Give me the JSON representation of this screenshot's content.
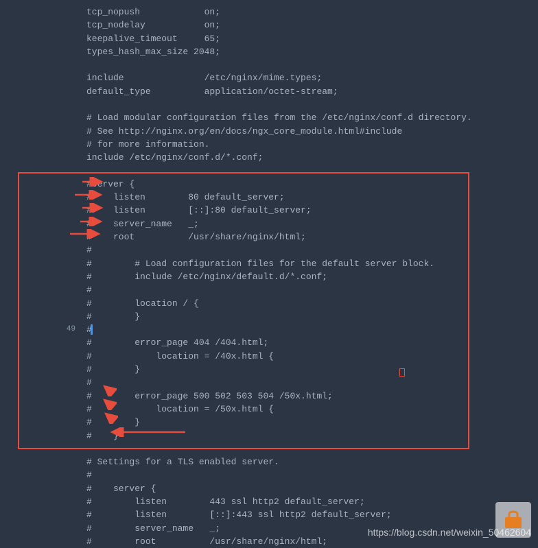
{
  "lines": [
    {
      "gutter": "",
      "code": "tcp_nopush            on;"
    },
    {
      "gutter": "",
      "code": "tcp_nodelay           on;"
    },
    {
      "gutter": "",
      "code": "keepalive_timeout     65;"
    },
    {
      "gutter": "",
      "code": "types_hash_max_size 2048;"
    },
    {
      "gutter": "",
      "code": ""
    },
    {
      "gutter": "",
      "code": "include               /etc/nginx/mime.types;"
    },
    {
      "gutter": "",
      "code": "default_type          application/octet-stream;"
    },
    {
      "gutter": "",
      "code": ""
    },
    {
      "gutter": "",
      "code": "# Load modular configuration files from the /etc/nginx/conf.d directory."
    },
    {
      "gutter": "",
      "code": "# See http://nginx.org/en/docs/ngx_core_module.html#include"
    },
    {
      "gutter": "",
      "code": "# for more information."
    },
    {
      "gutter": "",
      "code": "include /etc/nginx/conf.d/*.conf;"
    },
    {
      "gutter": "",
      "code": ""
    },
    {
      "gutter": "",
      "code": "#server {"
    },
    {
      "gutter": "",
      "code": "#    listen        80 default_server;"
    },
    {
      "gutter": "",
      "code": "#    listen        [::]:80 default_server;"
    },
    {
      "gutter": "",
      "code": "#    server_name   _;"
    },
    {
      "gutter": "",
      "code": "#    root          /usr/share/nginx/html;"
    },
    {
      "gutter": "",
      "code": "#"
    },
    {
      "gutter": "",
      "code": "#        # Load configuration files for the default server block."
    },
    {
      "gutter": "",
      "code": "#        include /etc/nginx/default.d/*.conf;"
    },
    {
      "gutter": "",
      "code": "#"
    },
    {
      "gutter": "",
      "code": "#        location / {"
    },
    {
      "gutter": "",
      "code": "#        }"
    },
    {
      "gutter": "49",
      "code": "#"
    },
    {
      "gutter": "",
      "code": "#        error_page 404 /404.html;"
    },
    {
      "gutter": "",
      "code": "#            location = /40x.html {"
    },
    {
      "gutter": "",
      "code": "#        }"
    },
    {
      "gutter": "",
      "code": "#"
    },
    {
      "gutter": "",
      "code": "#        error_page 500 502 503 504 /50x.html;"
    },
    {
      "gutter": "",
      "code": "#            location = /50x.html {"
    },
    {
      "gutter": "",
      "code": "#        }"
    },
    {
      "gutter": "",
      "code": "#    }"
    },
    {
      "gutter": "",
      "code": ""
    },
    {
      "gutter": "",
      "code": "# Settings for a TLS enabled server."
    },
    {
      "gutter": "",
      "code": "#"
    },
    {
      "gutter": "",
      "code": "#    server {"
    },
    {
      "gutter": "",
      "code": "#        listen        443 ssl http2 default_server;"
    },
    {
      "gutter": "",
      "code": "#        listen        [::]:443 ssl http2 default_server;"
    },
    {
      "gutter": "",
      "code": "#        server_name   _;"
    },
    {
      "gutter": "",
      "code": "#        root          /usr/share/nginx/html;"
    }
  ],
  "watermark": "https://blog.csdn.net/weixin_50462604",
  "line_number_49": "49"
}
